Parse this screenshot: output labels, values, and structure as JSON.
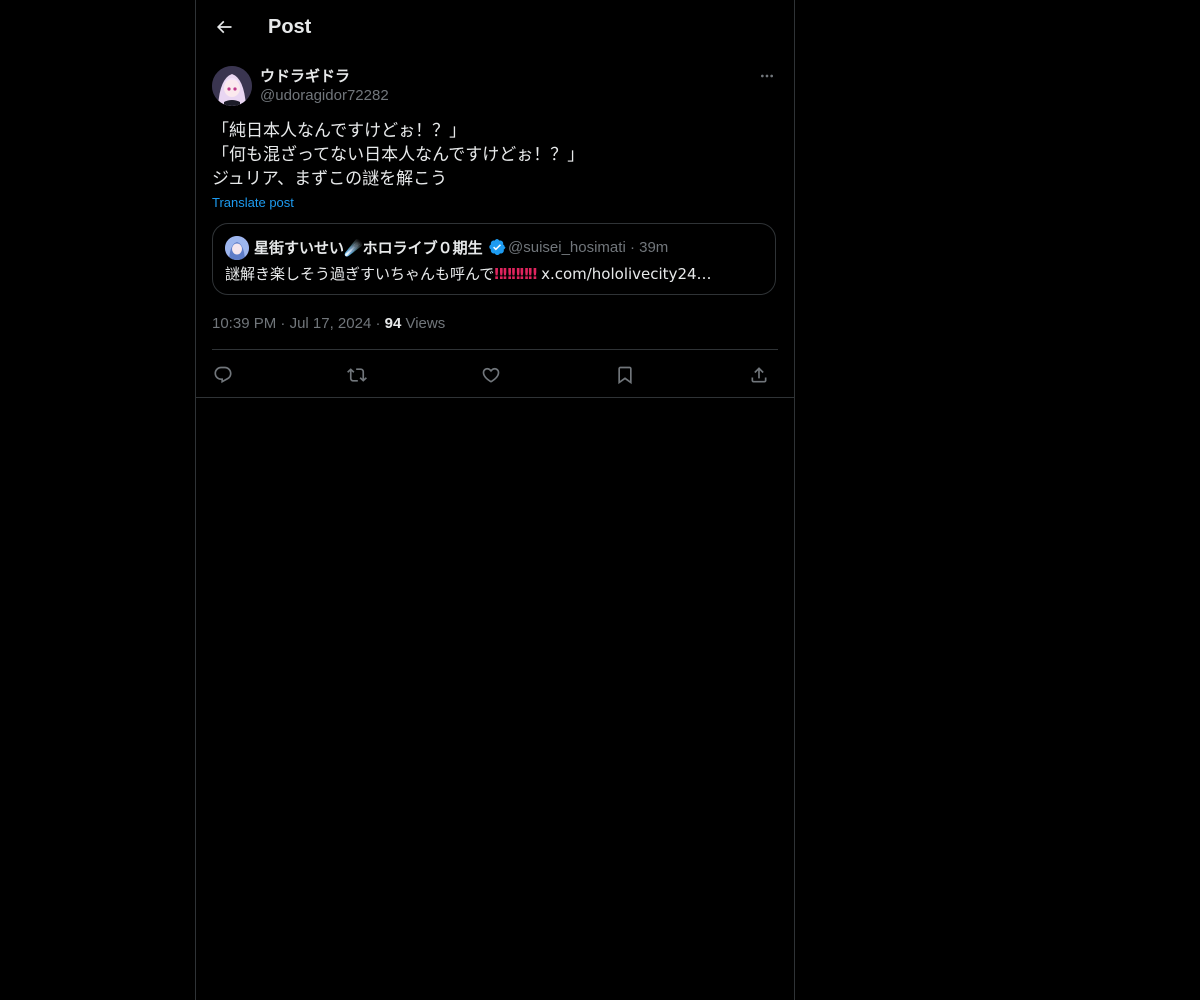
{
  "header": {
    "title": "Post",
    "back_icon": "arrow-left-icon"
  },
  "post": {
    "author": {
      "name": "ウドラギドラ",
      "handle": "@udoragidor72282"
    },
    "lines": [
      "「純日本人なんですけどぉ！？」",
      "「何も混ざってない日本人なんですけどぉ！？」",
      "ジュリア、まずこの謎を解こう"
    ],
    "translate_label": "Translate post",
    "quote": {
      "name": "星街すいせい☄️ホロライブ０期生",
      "verified_icon": "verified-badge-icon",
      "handle": "@suisei_hosimati",
      "separator": "·",
      "time": "39m",
      "text_prefix": "謎解き楽しそう過ぎすいちゃんも呼んで",
      "bangs": "‼‼‼‼‼",
      "link": " x.com/hololivecity24…"
    },
    "meta": {
      "time": "10:39 PM",
      "sep1": " · ",
      "date": "Jul 17, 2024",
      "sep2": " · ",
      "views_count": "94",
      "views_label": " Views"
    },
    "actions": [
      "reply-icon",
      "repost-icon",
      "like-icon",
      "bookmark-icon",
      "share-icon"
    ]
  },
  "colors": {
    "background": "#000000",
    "text": "#e7e9ea",
    "muted": "#71767b",
    "link": "#1d9bf0",
    "border": "#2f3336",
    "verified": "#1d9bf0"
  }
}
